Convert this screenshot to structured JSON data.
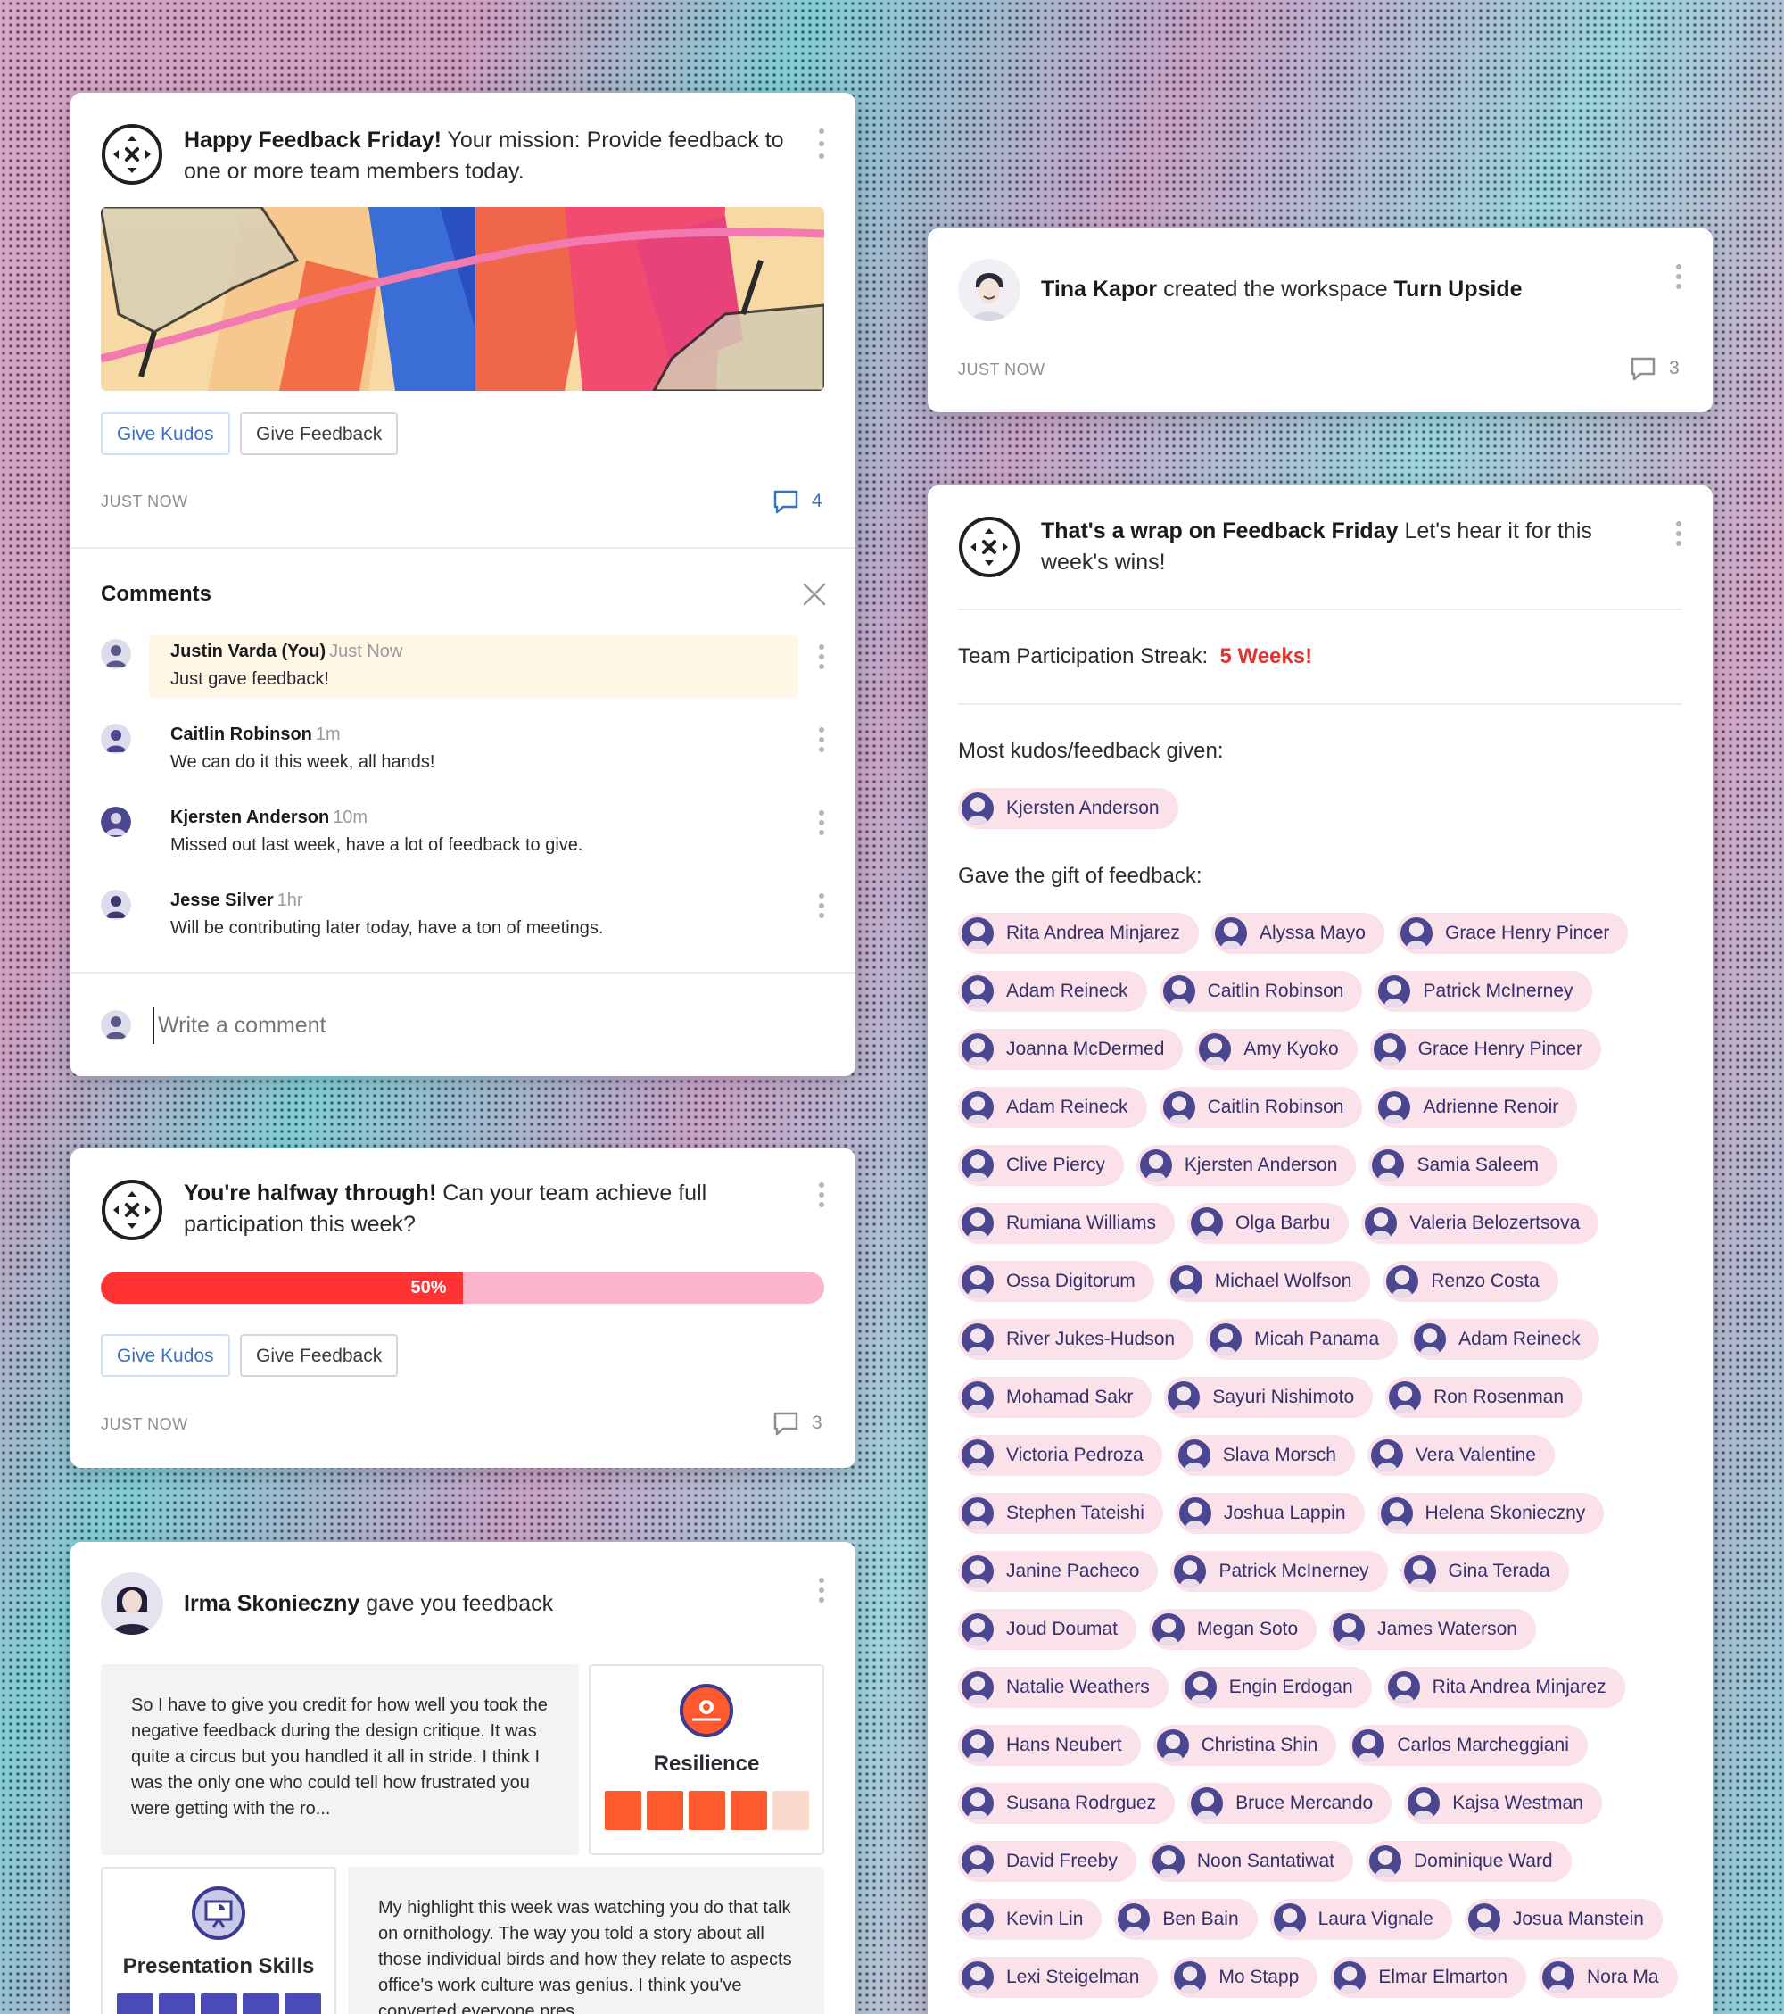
{
  "feedback_friday": {
    "title_bold": "Happy Feedback Friday!",
    "title_rest": " Your mission: Provide feedback to one or more team members today.",
    "give_kudos": "Give Kudos",
    "give_feedback": "Give Feedback",
    "time": "JUST NOW",
    "comment_count": "4",
    "comments_title": "Comments",
    "comments": [
      {
        "name": "Justin Varda (You)",
        "time": "Just Now",
        "text": "Just gave feedback!"
      },
      {
        "name": "Caitlin Robinson",
        "time": "1m",
        "text": "We can do it this week, all hands!"
      },
      {
        "name": "Kjersten Anderson",
        "time": "10m",
        "text": "Missed out last week, have a lot of feedback to give."
      },
      {
        "name": "Jesse Silver",
        "time": "1hr",
        "text": "Will be contributing later today, have a ton of meetings."
      }
    ],
    "comment_placeholder": "Write a comment"
  },
  "halfway": {
    "title_bold": "You're halfway through!",
    "title_rest": " Can your team achieve full participation this week?",
    "progress_pct": 50,
    "progress_label": "50%",
    "give_kudos": "Give Kudos",
    "give_feedback": "Give Feedback",
    "time": "JUST NOW",
    "comment_count": "3"
  },
  "feedback_card": {
    "giver": "Irma Skonieczny",
    "action": " gave you feedback",
    "quote1": "So I have to give you credit for how well you took the negative feedback during the design critique. It was quite a circus but you handled it all in stride. I think I was the only one who could tell how frustrated you were getting with the ro...",
    "skill1": "Resilience",
    "skill1_rating": 4,
    "skill2": "Presentation Skills",
    "skill2_rating": 5,
    "quote2": "My highlight this week was watching you do that talk on ornithology. The way you told a story about all those individual birds and how they relate to aspects office's work culture was genius. I think you've converted everyone pres"
  },
  "workspace": {
    "person": "Tina Kapor",
    "action": " created the workspace ",
    "workspace_name": "Turn Upside",
    "time": "JUST NOW",
    "comment_count": "3"
  },
  "wrap": {
    "title_bold": "That's a wrap on Feedback Friday",
    "title_rest": " Let's hear it for this week's wins!",
    "streak_label": "Team Participation Streak:",
    "streak_value": "5 Weeks!",
    "most_label": "Most kudos/feedback given:",
    "most_person": "Kjersten Anderson",
    "gift_label": "Gave the gift of feedback:",
    "givers": [
      "Rita Andrea Minjarez",
      "Alyssa Mayo",
      "Grace Henry Pincer",
      "Adam Reineck",
      "Caitlin Robinson",
      "Patrick McInerney",
      "Joanna McDermed",
      "Amy Kyoko",
      "Grace Henry Pincer",
      "Adam Reineck",
      "Caitlin Robinson",
      "Adrienne Renoir",
      "Clive Piercy",
      "Kjersten Anderson",
      "Samia Saleem",
      "Rumiana Williams",
      "Olga Barbu",
      "Valeria Belozertsova",
      "Ossa Digitorum",
      "Michael Wolfson",
      "Renzo Costa",
      "River Jukes-Hudson",
      "Micah Panama",
      "Adam Reineck",
      "Mohamad Sakr",
      "Sayuri Nishimoto",
      "Ron Rosenman",
      "Victoria Pedroza",
      "Slava Morsch",
      "Vera Valentine",
      "Stephen Tateishi",
      "Joshua Lappin",
      "Helena Skonieczny",
      "Janine Pacheco",
      "Patrick McInerney",
      "Gina Terada",
      "Joud Doumat",
      "Megan Soto",
      "James Waterson",
      "Natalie Weathers",
      "Engin Erdogan",
      "Rita Andrea Minjarez",
      "Hans Neubert",
      "Christina Shin",
      "Carlos Marcheggiani",
      "Susana Rodrguez",
      "Bruce Mercando",
      "Kajsa Westman",
      "David Freeby",
      "Noon Santatiwat",
      "Dominique Ward",
      "Kevin Lin",
      "Ben Bain",
      "Laura Vignale",
      "Josua Manstein",
      "Lexi Steigelman",
      "Mo Stapp",
      "Elmar Elmarton",
      "Nora Ma"
    ]
  },
  "colors": {
    "accent_blue": "#3a6fc4",
    "streak_red": "#e3342f",
    "progress_red": "#ff3333",
    "progress_pink": "#fbb5cf",
    "pill_bg": "#fbe1ea",
    "rating_orange": "#ff5a2d",
    "rating_empty": "#fbd9cc",
    "skill_purple": "#4b4bb8"
  }
}
